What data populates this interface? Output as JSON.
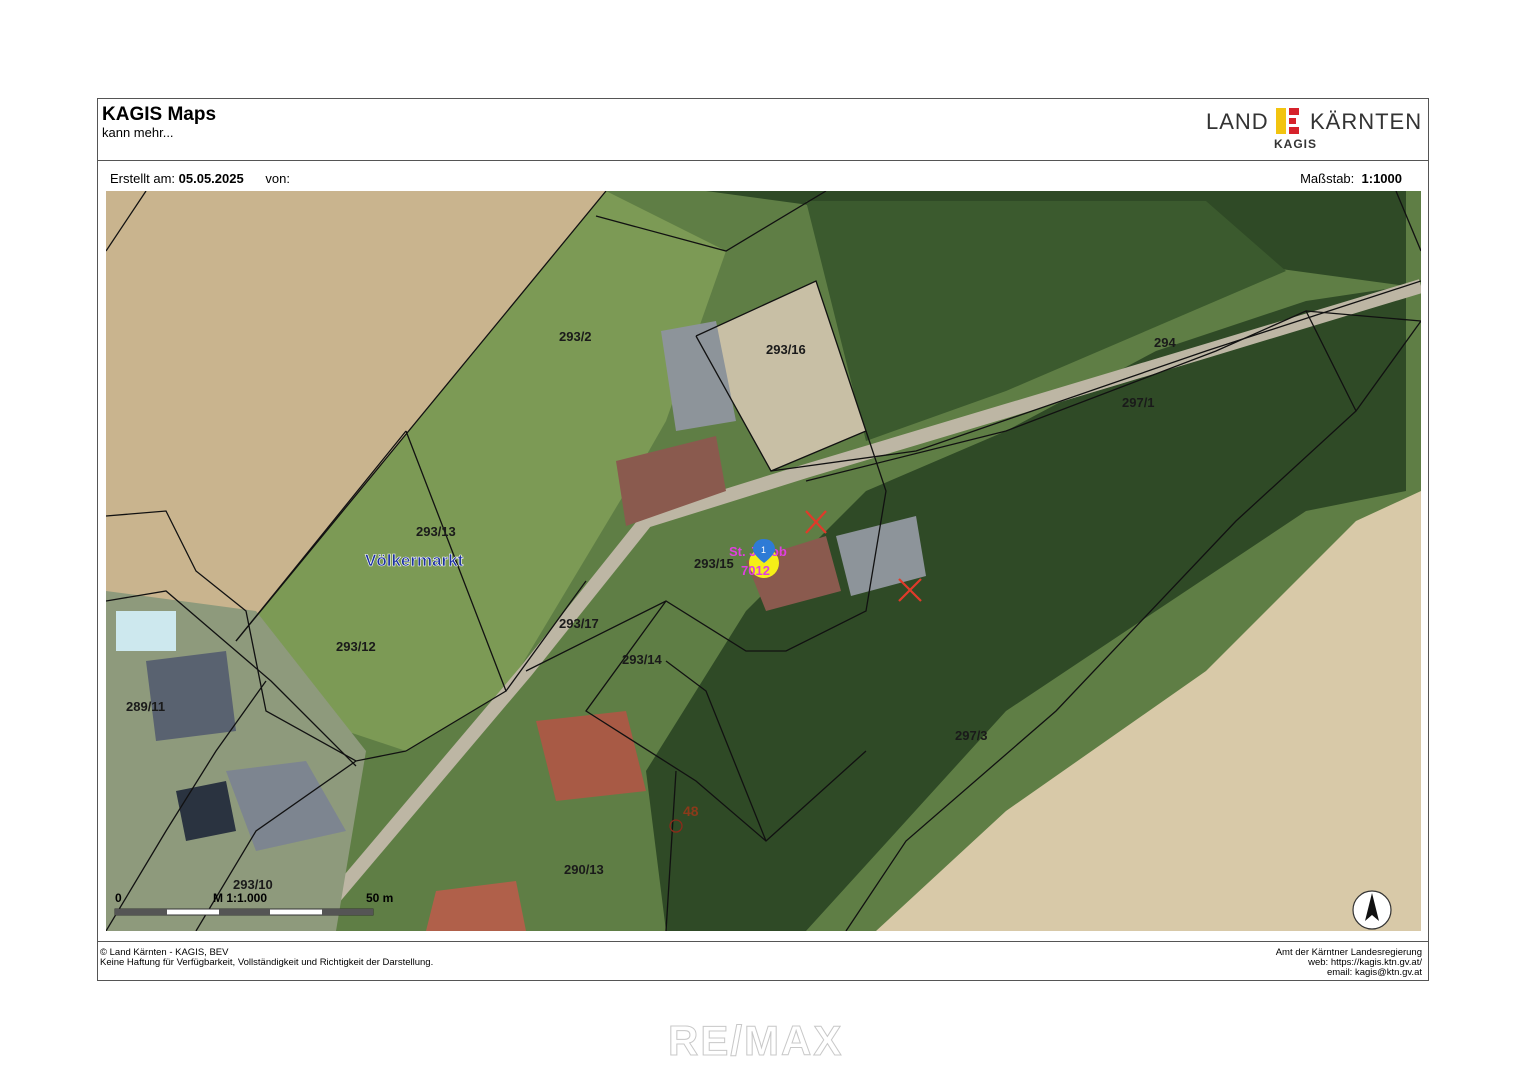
{
  "header": {
    "app_title": "KAGIS Maps",
    "app_subtitle": "kann mehr...",
    "logo_left": "LAND",
    "logo_right": "KÄRNTEN",
    "logo_sub": "KAGIS"
  },
  "meta": {
    "created_label": "Erstellt am:",
    "created_date": "05.05.2025",
    "by_label": "von:",
    "scale_label": "Maßstab:",
    "scale_value": "1:1000"
  },
  "map": {
    "town_label": "Völkermarkt",
    "marker_number": "1",
    "marker_label_top": "St. Jakob",
    "marker_label_bottom": "7012",
    "point_label": "48",
    "parcels": {
      "p293_2": "293/2",
      "p293_16": "293/16",
      "p294": "294",
      "p297_1": "297/1",
      "p293_13": "293/13",
      "p293_15": "293/15",
      "p293_17": "293/17",
      "p293_12": "293/12",
      "p293_14": "293/14",
      "p289_11": "289/11",
      "p297_3": "297/3",
      "p290_13": "290/13",
      "p293_10": "293/10"
    },
    "scalebar": {
      "start": "0",
      "ratio": "M 1:1.000",
      "end": "50 m"
    }
  },
  "footer": {
    "copyright": "© Land Kärnten - KAGIS, BEV",
    "disclaimer": "Keine Haftung für Verfügbarkeit, Vollständigkeit und Richtigkeit der Darstellung.",
    "org": "Amt der Kärntner Landesregierung",
    "web": "web: https://kagis.ktn.gv.at/",
    "email": "email: kagis@ktn.gv.at"
  },
  "watermark": "RE/MAX",
  "colors": {
    "marker_blue": "#2e7bd6",
    "marker_yellow": "#f5ef17",
    "marker_text": "#e040e0",
    "cross_red": "#e03a2a",
    "town_label": "#1a2fa0"
  }
}
